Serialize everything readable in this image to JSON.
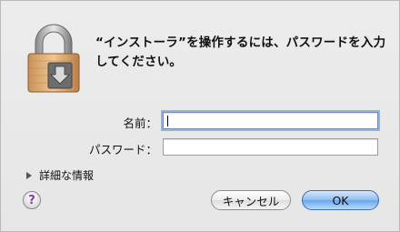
{
  "dialog": {
    "message": "“インストーラ”を操作するには、パスワードを入力してください。"
  },
  "form": {
    "name_label": "名前：",
    "name_value": "",
    "password_label": "パスワード：",
    "password_value": ""
  },
  "details": {
    "label": "詳細な情報"
  },
  "buttons": {
    "help": "?",
    "cancel": "キャンセル",
    "ok": "OK"
  },
  "icons": {
    "lock": "lock-icon",
    "disclosure": "disclosure-triangle-icon"
  }
}
